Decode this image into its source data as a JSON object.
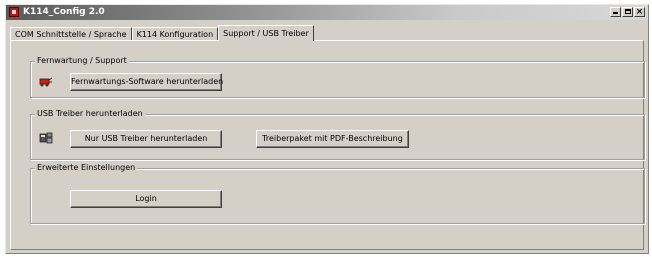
{
  "window": {
    "title": "K114_Config 2.0",
    "controls": {
      "minimize": "_",
      "maximize": "□",
      "close": "×"
    }
  },
  "tabs": [
    {
      "label": "COM Schnittstelle / Sprache"
    },
    {
      "label": "K114 Konfiguration"
    },
    {
      "label": "Support / USB Treiber"
    }
  ],
  "groups": {
    "remote": {
      "legend": "Fernwartung / Support",
      "icon": "remote-support-icon",
      "button": "Fernwartungs-Software herunterladen"
    },
    "usb": {
      "legend": "USB Treiber herunterladen",
      "icon": "usb-driver-icon",
      "button1": "Nur USB Treiber herunterladen",
      "button2": "Treiberpaket mit PDF-Beschreibung"
    },
    "advanced": {
      "legend": "Erweiterte Einstellungen",
      "button": "Login"
    }
  },
  "colors": {
    "face": "#d4d0c8",
    "title_dark": "#5a5a5a",
    "title_light": "#d8d8d8"
  }
}
